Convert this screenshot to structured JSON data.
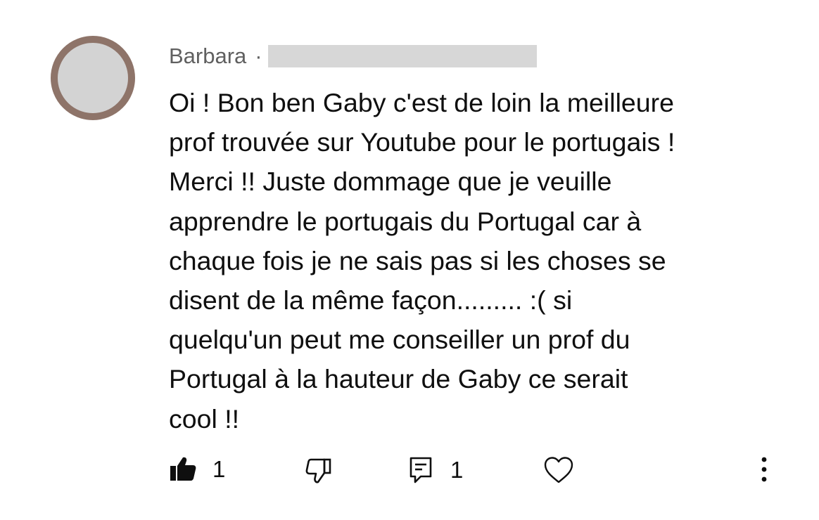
{
  "comment": {
    "author": "Barbara",
    "separator": "·",
    "body_lines": [
      "Oi ! Bon ben Gaby c'est de loin la meilleure",
      "prof trouvée sur Youtube pour le portugais !",
      "Merci !! Juste dommage que je veuille",
      "apprendre le portugais du Portugal car à",
      "chaque fois je ne sais pas si les choses se",
      "disent de la même façon......... :( si",
      "quelqu'un peut me conseiller un prof du",
      "Portugal à la hauteur de Gaby ce serait",
      "cool !!"
    ]
  },
  "actions": {
    "like_count": "1",
    "reply_count": "1"
  },
  "icons": {
    "like": "thumbs-up-filled-icon",
    "dislike": "thumbs-down-outline-icon",
    "reply": "comment-reply-icon",
    "heart": "heart-outline-icon",
    "more": "more-vertical-icon"
  },
  "colors": {
    "avatar_ring": "#8e7469",
    "avatar_fill": "#d3d3d3",
    "meta_text": "#606060",
    "redaction": "#d7d7d7",
    "text": "#0f0f0f"
  }
}
